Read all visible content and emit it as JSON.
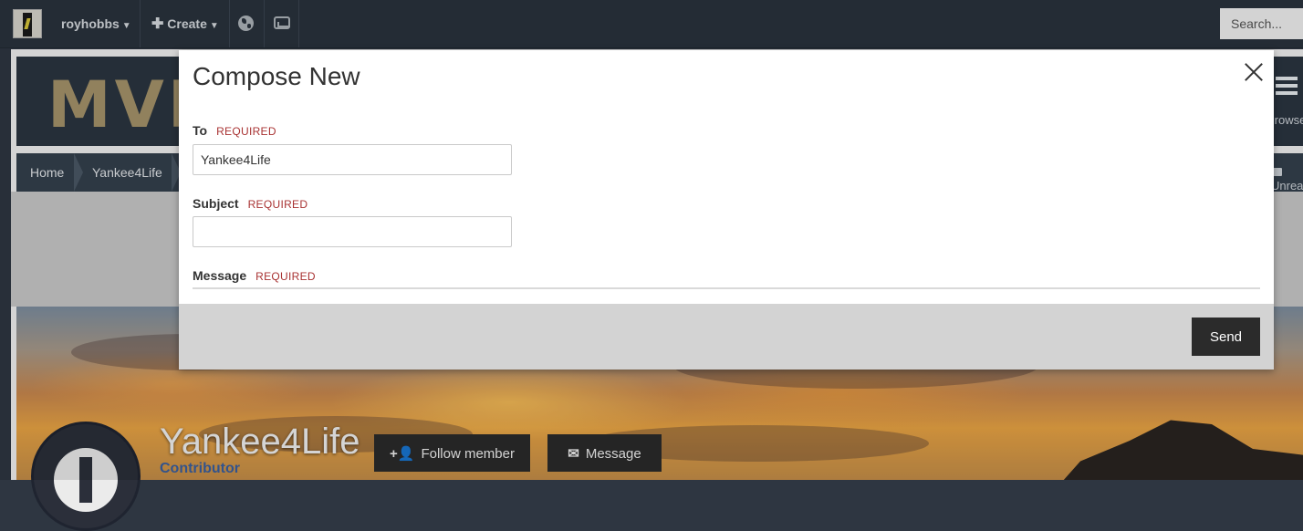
{
  "topbar": {
    "username": "royhobbs",
    "create_label": "Create",
    "search_placeholder": "Search..."
  },
  "site": {
    "logo_text": "MVP",
    "browse_label": "Browse",
    "unread_label": "Unread"
  },
  "breadcrumb": [
    "Home",
    "Yankee4Life"
  ],
  "profile": {
    "name": "Yankee4Life",
    "role": "Contributor",
    "follow_label": "Follow member",
    "message_label": "Message"
  },
  "modal": {
    "title": "Compose New",
    "to_label": "To",
    "to_value": "Yankee4Life",
    "subject_label": "Subject",
    "subject_value": "",
    "message_label": "Message",
    "required_label": "REQUIRED",
    "send_label": "Send"
  },
  "colors": {
    "topbar_bg": "#2a333d",
    "required_text": "#a83232",
    "button_dark": "#2b2b2b",
    "footer_bg": "#d3d3d3"
  }
}
